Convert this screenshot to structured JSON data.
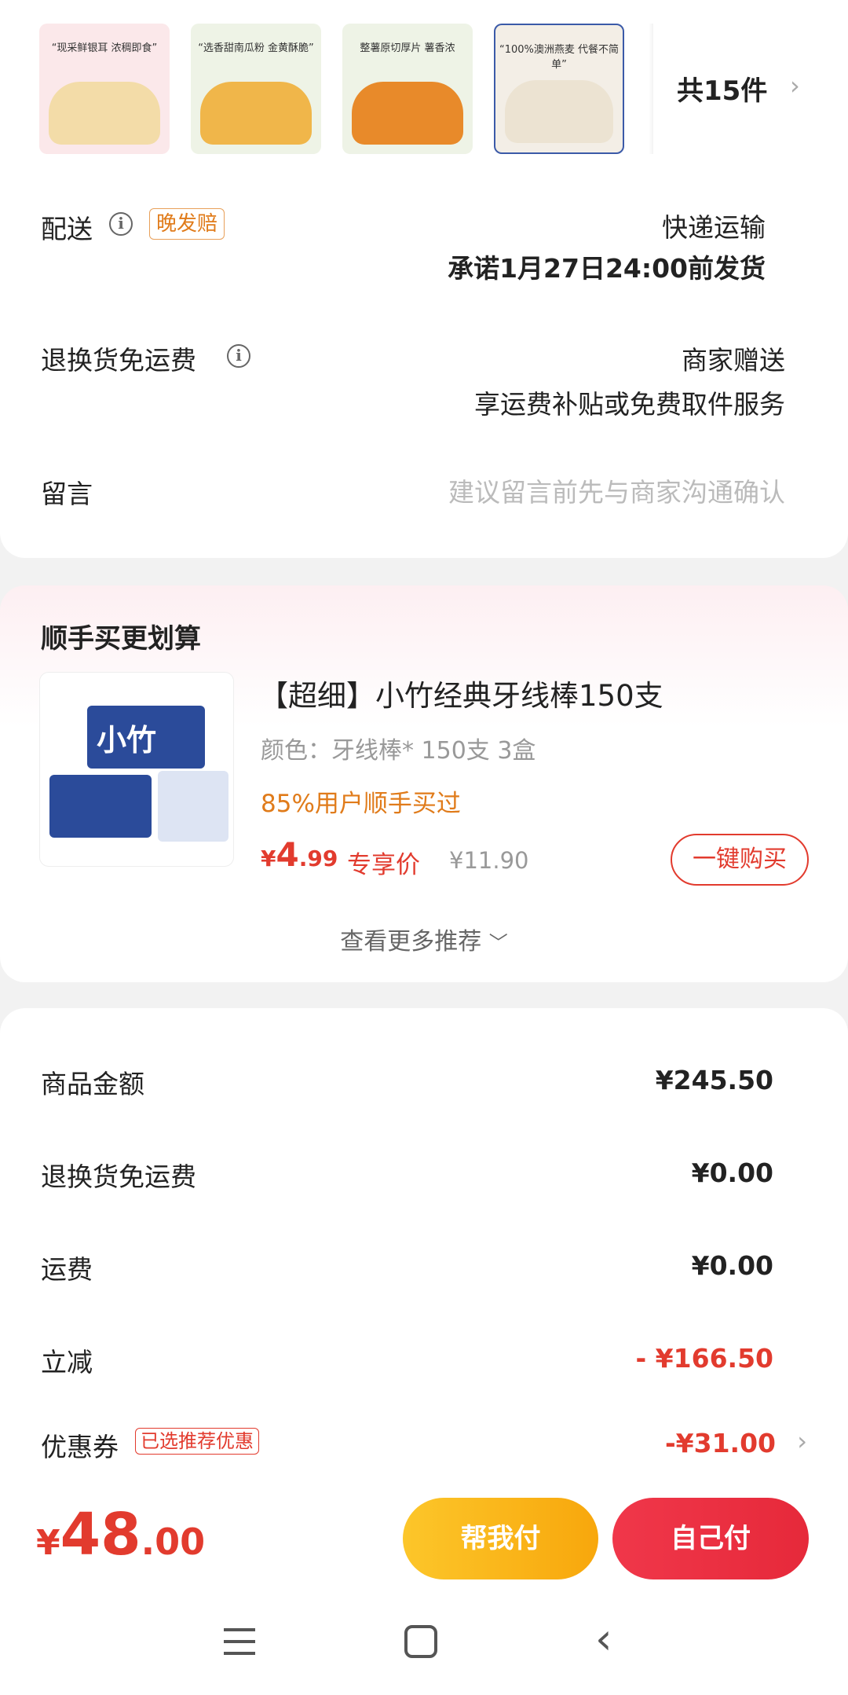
{
  "products": {
    "thumbs": [
      {
        "caption": "“现采鲜银耳 浓稠即食”",
        "bg": "#fbe8ea",
        "food": "#f3d9a0"
      },
      {
        "caption": "“选香甜南瓜粉 金黄酥脆”",
        "bg": "#eef3e6",
        "food": "#f0b64a"
      },
      {
        "caption": "整薯原切厚片 薯香浓",
        "bg": "#eef3e6",
        "food": "#e88a2a"
      },
      {
        "caption": "“100%澳洲燕麦 代餐不简单”",
        "bg": "#f3eee6",
        "food": "#ece3d2"
      }
    ],
    "count_label": "共15件"
  },
  "delivery": {
    "label": "配送",
    "tag": "晚发赔",
    "method": "快递运输",
    "promise": "承诺1月27日24:00前发货"
  },
  "return_shipping": {
    "label": "退换货免运费",
    "value": "商家赠送",
    "desc": "享运费补贴或免费取件服务"
  },
  "message": {
    "label": "留言",
    "placeholder": "建议留言前先与商家沟通确认"
  },
  "recommend": {
    "title": "顺手买更划算",
    "product": {
      "title": "【超细】小竹经典牙线棒150支",
      "spec": "颜色：牙线棒* 150支 3盒",
      "bought": "85%用户顺手买过",
      "price_symbol": "¥",
      "price_int": "4",
      "price_dec": ".99",
      "price_tag": "专享价",
      "orig_price": "¥11.90",
      "buy_button": "一键购买",
      "image_text": "小竹"
    },
    "more": "查看更多推荐"
  },
  "summary": {
    "rows": [
      {
        "label": "商品金额",
        "value": "¥245.50"
      },
      {
        "label": "退换货免运费",
        "value": "¥0.00"
      },
      {
        "label": "运费",
        "value": "¥0.00"
      },
      {
        "label": "立减",
        "value": "- ¥166.50"
      },
      {
        "label": "优惠券",
        "value": "-¥31.00",
        "tag": "已选推荐优惠"
      }
    ]
  },
  "footer": {
    "total_symbol": "¥",
    "total_int": "48",
    "total_dec": ".00",
    "help_pay": "帮我付",
    "self_pay": "自己付"
  },
  "colors": {
    "accent_red": "#e23b2e",
    "accent_orange": "#e07b1a",
    "help_btn": "#fbb615",
    "self_btn": "#ec2f3e"
  }
}
